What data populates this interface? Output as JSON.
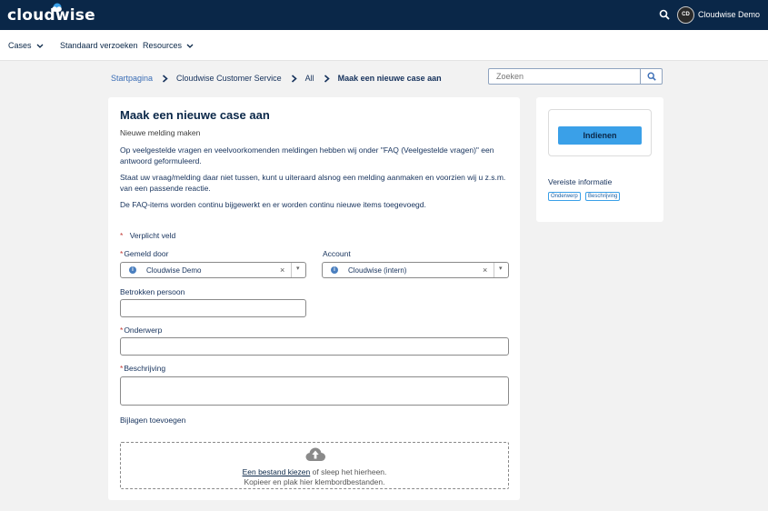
{
  "topbar": {
    "logo_text": "cloudwise",
    "avatar_initials": "CD",
    "user_name": "Cloudwise Demo"
  },
  "nav": {
    "items": [
      {
        "label": "Cases"
      },
      {
        "label": "Standaard verzoeken"
      },
      {
        "label": "Resources"
      }
    ]
  },
  "breadcrumb": [
    "Startpagina",
    "Cloudwise Customer Service",
    "All",
    "Maak een nieuwe case aan"
  ],
  "search": {
    "placeholder": "Zoeken"
  },
  "form": {
    "title": "Maak een nieuwe case aan",
    "subtitle": "Nieuwe melding maken",
    "paragraphs": [
      "Op veelgestelde vragen en veelvoorkomenden meldingen hebben wij onder \"FAQ (Veelgestelde vragen)\" een antwoord geformuleerd.",
      "Staat uw vraag/melding daar niet tussen, kunt u uiteraard alsnog een melding aanmaken en voorzien wij u z.s.m. van een passende reactie.",
      "De FAQ-items worden continu bijgewerkt en er worden continu nieuwe items toegevoegd."
    ],
    "required_note": "Verplicht veld",
    "required_marker": "*",
    "gemeld_door": {
      "label": "Gemeld door",
      "value": "Cloudwise Demo"
    },
    "account": {
      "label": "Account",
      "value": "Cloudwise (intern)"
    },
    "betrokken_label": "Betrokken persoon",
    "onderwerp_label": "Onderwerp",
    "beschrijving_label": "Beschrijving",
    "bijlagen_label": "Bijlagen toevoegen",
    "upload": {
      "link": "Een bestand kiezen",
      "line1_rest": " of sleep het hierheen.",
      "line2": "Kopieer en plak hier klembordbestanden."
    }
  },
  "side": {
    "submit_label": "Indienen",
    "required_info_title": "Vereiste informatie",
    "tags": [
      "Onderwerp",
      "Beschrijving"
    ]
  }
}
